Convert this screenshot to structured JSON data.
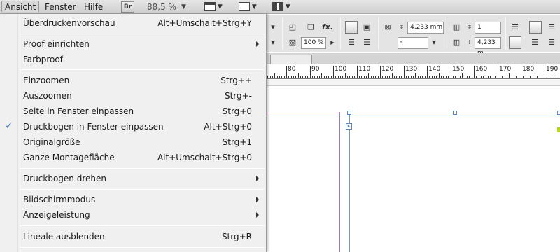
{
  "menubar": {
    "items": [
      {
        "label": "Ansicht"
      },
      {
        "label": "Fenster"
      },
      {
        "label": "Hilfe"
      }
    ],
    "bridge_label": "Br",
    "zoom_value": "88,5 %"
  },
  "menu": {
    "items": [
      {
        "label": "Überdruckenvorschau",
        "shortcut": "Alt+Umschalt+Strg+Y"
      },
      {
        "label": "Proof einrichten",
        "shortcut": ""
      },
      {
        "label": "Farbproof",
        "shortcut": ""
      },
      {
        "label": "Einzoomen",
        "shortcut": "Strg++"
      },
      {
        "label": "Auszoomen",
        "shortcut": "Strg+-"
      },
      {
        "label": "Seite in Fenster einpassen",
        "shortcut": "Strg+0"
      },
      {
        "label": "Druckbogen in Fenster einpassen",
        "shortcut": "Alt+Strg+0"
      },
      {
        "label": "Originalgröße",
        "shortcut": "Strg+1"
      },
      {
        "label": "Ganze Montagefläche",
        "shortcut": "Alt+Umschalt+Strg+0"
      },
      {
        "label": "Druckbogen drehen",
        "shortcut": ""
      },
      {
        "label": "Bildschirmmodus",
        "shortcut": ""
      },
      {
        "label": "Anzeigeleistung",
        "shortcut": ""
      },
      {
        "label": "Lineale ausblenden",
        "shortcut": "Strg+R"
      }
    ],
    "checked_item": "Druckbogen in Fenster einpassen"
  },
  "control": {
    "stroke_weight": "4,233 mm",
    "stroke_weight2": "4,233 m",
    "columns": "1",
    "opacity": "100 %",
    "fx_label": "fx."
  },
  "ruler": {
    "labels": [
      "80",
      "90",
      "100",
      "110",
      "120",
      "130",
      "140",
      "150",
      "160",
      "170",
      "180",
      "190"
    ]
  }
}
